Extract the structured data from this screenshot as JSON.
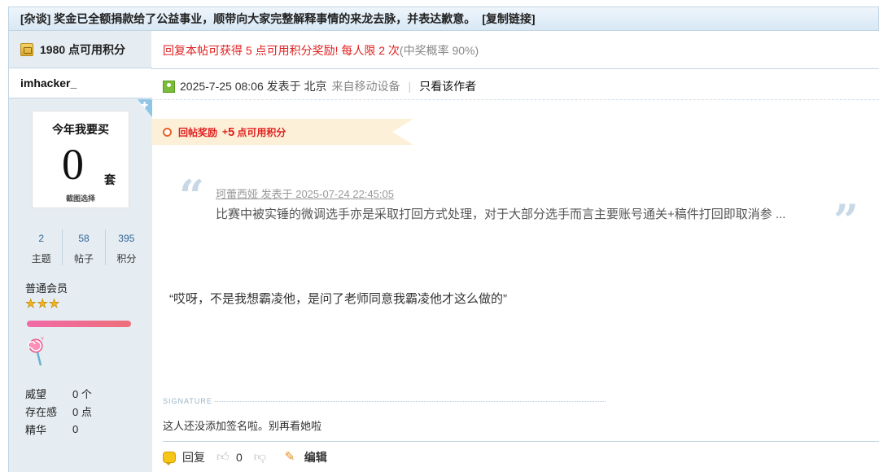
{
  "thread": {
    "title": "[杂谈] 奖金已全额捐款给了公益事业，顺带向大家完整解释事情的来龙去脉，并表达歉意。",
    "copy_link": "[复制链接]"
  },
  "sidebar": {
    "points": "1980 点可用积分",
    "username": "imhacker_",
    "avatar_card": {
      "title": "今年我要买",
      "number": "0",
      "unit": "套",
      "caption": "截图选择"
    },
    "stats": [
      {
        "value": "2",
        "label": "主题"
      },
      {
        "value": "58",
        "label": "帖子"
      },
      {
        "value": "395",
        "label": "积分"
      }
    ],
    "group": "普通会员",
    "star_count": 3,
    "progress_fraction": 1.0,
    "info": [
      {
        "key": "威望",
        "value": "0 个"
      },
      {
        "key": "存在感",
        "value": "0 点"
      },
      {
        "key": "精华",
        "value": "0"
      }
    ]
  },
  "post": {
    "reward_text_red": "回复本帖可获得 5 点可用积分奖励! 每人限 2 次",
    "reward_text_gray": "(中奖概率 90%)",
    "meta": {
      "posted_line": "2025-7-25 08:06 发表于 北京",
      "device": "来自移动设备",
      "separator": "|",
      "author_only": "只看该作者"
    },
    "bonus": {
      "label": "回帖奖励",
      "plus": "+",
      "amount": "5",
      "unit": "点可用积分"
    },
    "quote": {
      "header": "珂蕾西娅 发表于 2025-07-24 22:45:05",
      "body": "比赛中被实锤的微调选手亦是采取打回方式处理，对于大部分选手而言主要账号通关+稿件打回即取消参 ..."
    },
    "message": "“哎呀，不是我想霸凌他，是问了老师同意我霸凌他才这么做的”",
    "signature_label": "SIGNATURE",
    "signature_text": "这人还没添加签名啦。别再看她啦",
    "actions": {
      "reply": "回复",
      "like_count": "0",
      "edit": "编辑"
    }
  },
  "colors": {
    "accent_red": "#e02020",
    "sidebar_bg": "#e5edf2",
    "border_blue": "#c2d5e3",
    "link_blue": "#336699"
  }
}
